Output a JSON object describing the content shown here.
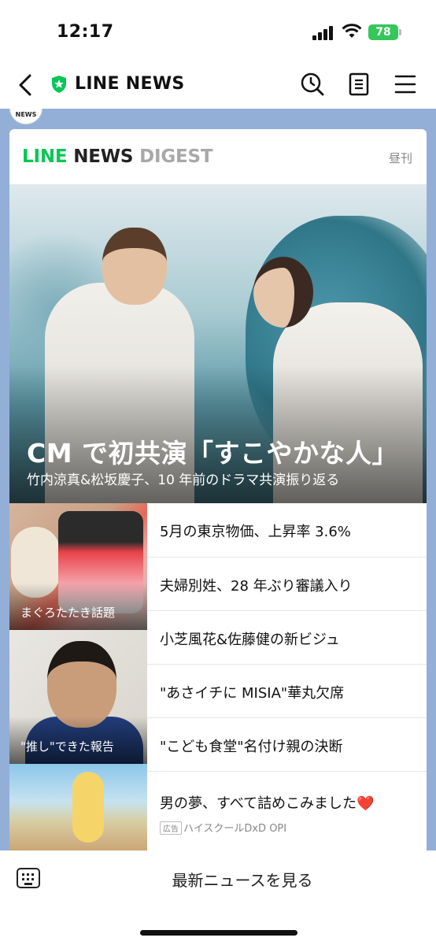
{
  "status_bar": {
    "time": "12:17",
    "battery": "78"
  },
  "header": {
    "title": "LINE NEWS",
    "icons": [
      "back-chevron-icon",
      "shield-star-icon",
      "history-clock-icon",
      "article-list-icon",
      "hamburger-menu-icon"
    ]
  },
  "avatar_text": "NEWS",
  "digest": {
    "logo_line": "LINE",
    "logo_news": "NEWS",
    "logo_digest": "DIGEST",
    "edition": "昼刊",
    "hero": {
      "title": "CM で初共演「すこやかな人」",
      "subtitle": "竹内涼真&松坂慶子、10 年前のドラマ共演振り返る"
    },
    "thumbnails": [
      {
        "caption": "まぐろたたき話題"
      },
      {
        "caption": "\"推し\"できた報告"
      }
    ],
    "headlines": [
      "5月の東京物価、上昇率 3.6%",
      "夫婦別姓、28 年ぶり審議入り",
      "小芝風花&佐藤健の新ビジュ",
      "\"あさイチに MISIA\"華丸欠席",
      "\"こども食堂\"名付け親の決断"
    ],
    "ad": {
      "title": "男の夢、すべて詰めこみました",
      "heart": "❤️",
      "label": "広告",
      "sponsor": "ハイスクールDxD OPI"
    }
  },
  "bottom_bar": {
    "latest_label": "最新ニュースを見る"
  },
  "colors": {
    "brand_green": "#06c755",
    "page_blue": "#93afd7",
    "battery_green": "#34c759"
  }
}
